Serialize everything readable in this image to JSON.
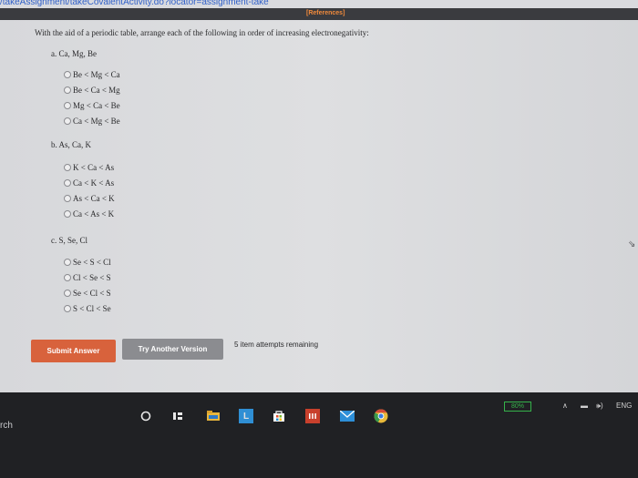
{
  "browser": {
    "url_fragment": "/takeAssignment/takeCovalentActivity.do?locator=assignment-take"
  },
  "header": {
    "references_label": "[References]"
  },
  "question": {
    "prompt": "With the aid of a periodic table, arrange each of the following in order of increasing electronegativity:",
    "parts": [
      {
        "label": "a. Ca, Mg, Be",
        "options": [
          "Be < Mg < Ca",
          "Be < Ca < Mg",
          "Mg < Ca < Be",
          "Ca < Mg < Be"
        ]
      },
      {
        "label": "b. As, Ca, K",
        "options": [
          "K < Ca < As",
          "Ca < K < As",
          "As < Ca < K",
          "Ca < As < K"
        ]
      },
      {
        "label": "c. S, Se, Cl",
        "options": [
          "Se < S < Cl",
          "Cl < Se < S",
          "Se < Cl < S",
          "S < Cl < Se"
        ]
      }
    ]
  },
  "actions": {
    "submit_label": "Submit Answer",
    "try_another_label": "Try Another Version",
    "attempts_text": "5 item attempts remaining"
  },
  "taskbar": {
    "search_text": "rch",
    "battery_text": "80%",
    "language": "ENG",
    "icons": [
      "cortana-circle-icon",
      "task-view-icon",
      "file-explorer-icon",
      "app-l-icon",
      "store-icon",
      "office-icon",
      "mail-icon",
      "chrome-icon"
    ]
  },
  "colors": {
    "submit": "#d8623c",
    "try_another": "#8b8c90",
    "references": "#f08a3c",
    "battery": "#35b24a"
  }
}
